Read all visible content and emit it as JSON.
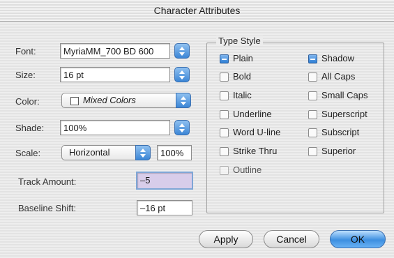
{
  "dialog": {
    "title": "Character Attributes"
  },
  "fields": {
    "font": {
      "label": "Font:",
      "value": "MyriaMM_700 BD 600"
    },
    "size": {
      "label": "Size:",
      "value": "16 pt"
    },
    "color": {
      "label": "Color:",
      "value": "Mixed Colors"
    },
    "shade": {
      "label": "Shade:",
      "value": "100%"
    },
    "scale": {
      "label": "Scale:",
      "value": "Horizontal",
      "amount": "100%"
    },
    "track": {
      "label": "Track Amount:",
      "value": "–5"
    },
    "baseline": {
      "label": "Baseline Shift:",
      "value": "–16 pt"
    }
  },
  "type_style": {
    "title": "Type Style",
    "left": [
      {
        "label": "Plain",
        "checked": true
      },
      {
        "label": "Bold",
        "checked": false
      },
      {
        "label": "Italic",
        "checked": false
      },
      {
        "label": "Underline",
        "checked": false
      },
      {
        "label": "Word U-line",
        "checked": false
      },
      {
        "label": "Strike Thru",
        "checked": false
      },
      {
        "label": "Outline",
        "checked": false
      }
    ],
    "right": [
      {
        "label": "Shadow",
        "checked": true
      },
      {
        "label": "All Caps",
        "checked": false
      },
      {
        "label": "Small Caps",
        "checked": false
      },
      {
        "label": "Superscript",
        "checked": false
      },
      {
        "label": "Subscript",
        "checked": false
      },
      {
        "label": "Superior",
        "checked": false
      }
    ]
  },
  "buttons": {
    "apply": "Apply",
    "cancel": "Cancel",
    "ok": "OK"
  },
  "colors": {
    "accent": "#3c86d6",
    "selection": "#d8cdea"
  }
}
